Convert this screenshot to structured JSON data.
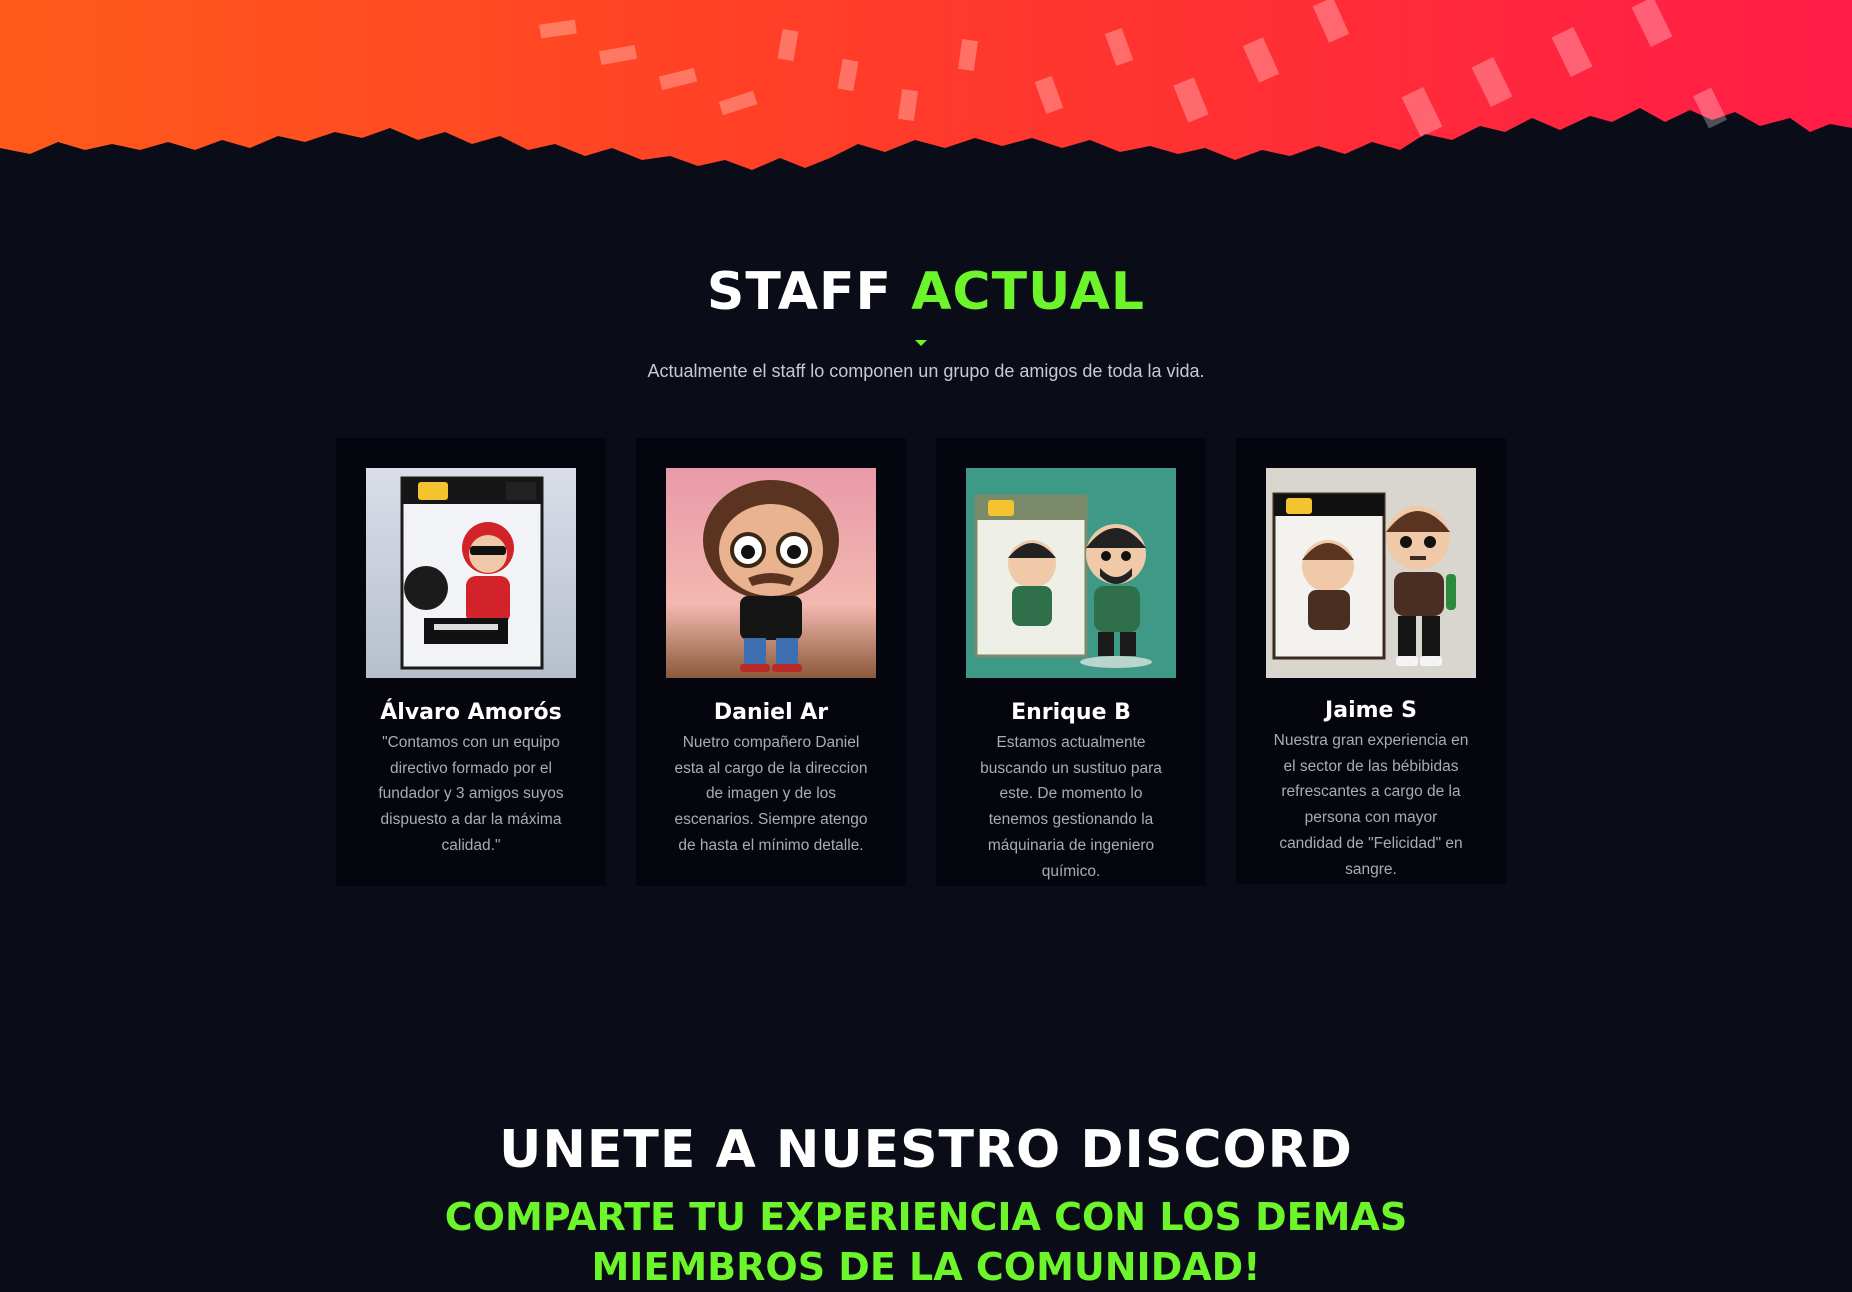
{
  "colors": {
    "background": "#0a0c18",
    "accent": "#6cf52a",
    "card_background": "#05060d",
    "hero_gradient_start": "#ff5a1a",
    "hero_gradient_end": "#ff1c48"
  },
  "staff_section": {
    "title_main": "STAFF",
    "title_accent": "ACTUAL",
    "subtitle": "Actualmente el staff lo componen un grupo de amigos de toda la vida.",
    "members": [
      {
        "name": "Álvaro Amorós",
        "description": "\"Contamos con un equipo directivo formado por el fundador y 3 amigos suyos dispuesto a dar la máxima calidad.\"",
        "photo_icon": "funko-pop-java-figure"
      },
      {
        "name": "Daniel Ar",
        "description": "Nuetro compañero Daniel esta al cargo de la direccion de imagen y de los escenarios. Siempre atengo de hasta el mínimo detalle.",
        "photo_icon": "funko-figure-glasses"
      },
      {
        "name": "Enrique B",
        "description": "Estamos actualmente buscando un sustituo para este. De momento lo tenemos gestionando la máquinaria de ingeniero químico.",
        "photo_icon": "funko-pop-chemical-figure"
      },
      {
        "name": "Jaime S",
        "description": "Nuestra gran experiencia en el sector de las bébibidas refrescantes a cargo de la persona con mayor candidad de \"Felicidad\" en sangre.",
        "photo_icon": "funko-pop-jaime-figure"
      }
    ]
  },
  "discord_section": {
    "title": "UNETE A NUESTRO DISCORD",
    "subtitle": "COMPARTE TU EXPERIENCIA CON LOS DEMAS MIEMBROS DE LA COMUNIDAD!"
  }
}
